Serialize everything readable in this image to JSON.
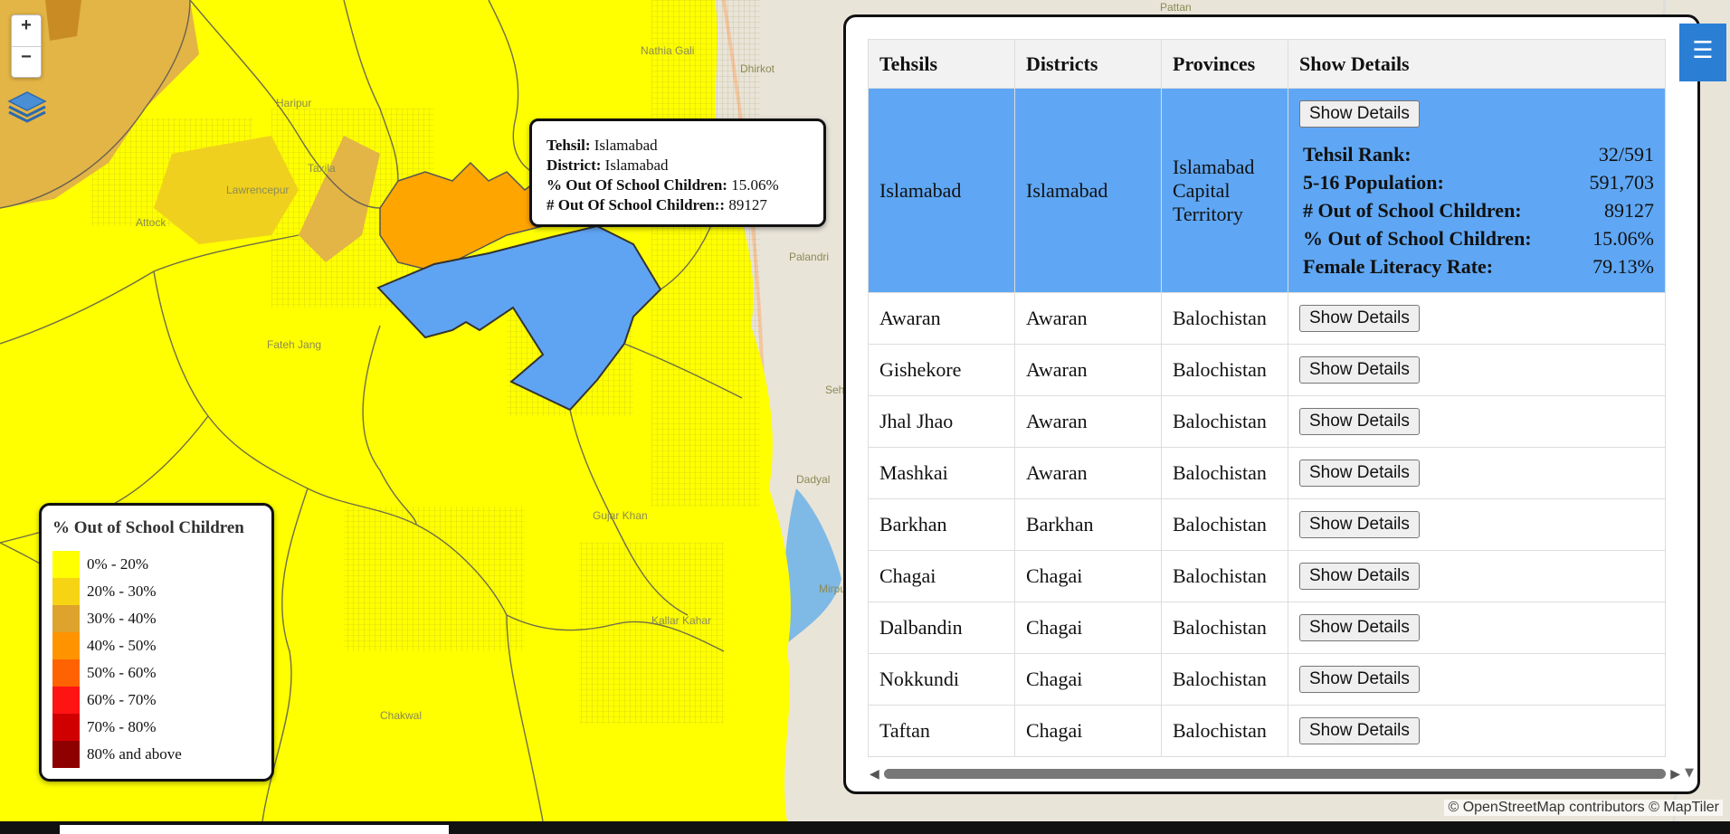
{
  "map": {
    "place_labels": [
      "Haripur",
      "Gujar Khan",
      "Mirpur",
      "Chakwal",
      "Taxila",
      "Attock",
      "Dadyal",
      "Sehnsa",
      "Palandri",
      "Fateh Jang",
      "Dhirkot",
      "Nathia Gali",
      "Lawrencepur",
      "Kallar Kahar",
      "Pattan"
    ],
    "selected_region": "Islamabad",
    "colors": {
      "base_yellow": "#ffff00",
      "selected_blue": "#5fa4f2",
      "orange": "#ffa500",
      "ochre": "#e0b040",
      "gold": "#f0d020",
      "water": "#7fb9e6"
    }
  },
  "zoom": {
    "in_label": "+",
    "out_label": "−"
  },
  "tooltip": {
    "tehsil_label": "Tehsil:",
    "tehsil_value": "Islamabad",
    "district_label": "District:",
    "district_value": "Islamabad",
    "pct_label": "% Out Of School Children:",
    "pct_value": "15.06%",
    "num_label": "# Out Of School Children::",
    "num_value": "89127"
  },
  "legend": {
    "title": "% Out of School Children",
    "items": [
      {
        "label": "0% - 20%",
        "color": "#ffff00"
      },
      {
        "label": "20% - 30%",
        "color": "#f6d414"
      },
      {
        "label": "30% - 40%",
        "color": "#dea32c"
      },
      {
        "label": "40% - 50%",
        "color": "#ff9400"
      },
      {
        "label": "50% - 60%",
        "color": "#ff6200"
      },
      {
        "label": "60% - 70%",
        "color": "#ff1414"
      },
      {
        "label": "70% - 80%",
        "color": "#d10000"
      },
      {
        "label": "80% and above",
        "color": "#8e0000"
      }
    ]
  },
  "table": {
    "headers": [
      "Tehsils",
      "Districts",
      "Provinces",
      "Show Details"
    ],
    "button_label": "Show Details",
    "selected": {
      "tehsil": "Islamabad",
      "district": "Islamabad",
      "province": "Islamabad Capital Territory",
      "details": [
        {
          "label": "Tehsil Rank:",
          "value": "32/591"
        },
        {
          "label": "5-16 Population:",
          "value": "591,703"
        },
        {
          "label": "# Out of School Children:",
          "value": "89127"
        },
        {
          "label": "% Out of School Children:",
          "value": "15.06%"
        },
        {
          "label": "Female Literacy Rate:",
          "value": "79.13%"
        }
      ]
    },
    "rows": [
      {
        "tehsil": "Awaran",
        "district": "Awaran",
        "province": "Balochistan"
      },
      {
        "tehsil": "Gishekore",
        "district": "Awaran",
        "province": "Balochistan"
      },
      {
        "tehsil": "Jhal Jhao",
        "district": "Awaran",
        "province": "Balochistan"
      },
      {
        "tehsil": "Mashkai",
        "district": "Awaran",
        "province": "Balochistan"
      },
      {
        "tehsil": "Barkhan",
        "district": "Barkhan",
        "province": "Balochistan"
      },
      {
        "tehsil": "Chagai",
        "district": "Chagai",
        "province": "Balochistan"
      },
      {
        "tehsil": "Dalbandin",
        "district": "Chagai",
        "province": "Balochistan"
      },
      {
        "tehsil": "Nokkundi",
        "district": "Chagai",
        "province": "Balochistan"
      },
      {
        "tehsil": "Taftan",
        "district": "Chagai",
        "province": "Balochistan"
      }
    ]
  },
  "menu_icon": "☰",
  "attribution": "© OpenStreetMap contributors © MapTiler"
}
